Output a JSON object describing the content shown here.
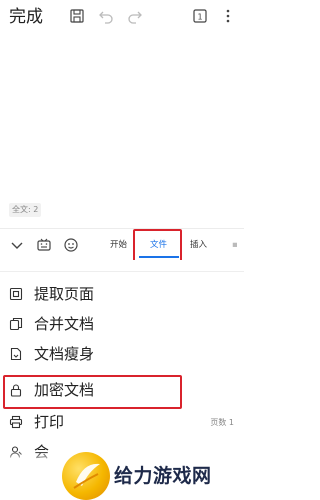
{
  "topbar": {
    "done_label": "完成"
  },
  "editor": {
    "word_count": "全文: 2"
  },
  "toolbar": {
    "tabs": [
      {
        "label": "开始"
      },
      {
        "label": "文件",
        "active": true
      },
      {
        "label": "插入"
      }
    ]
  },
  "menu": {
    "items": [
      {
        "label": "提取页面",
        "icon": "extract-pages-icon"
      },
      {
        "label": "合并文档",
        "icon": "merge-docs-icon"
      },
      {
        "label": "文档瘦身",
        "icon": "slim-doc-icon"
      },
      {
        "label": "加密文档",
        "icon": "lock-icon"
      },
      {
        "label": "打印",
        "icon": "printer-icon",
        "right": "页数 1"
      },
      {
        "label": "会",
        "icon": "person-icon"
      }
    ]
  },
  "watermark": {
    "brand": "给力游戏网"
  },
  "colors": {
    "accent": "#1a73e8",
    "highlight": "#d9232c"
  }
}
